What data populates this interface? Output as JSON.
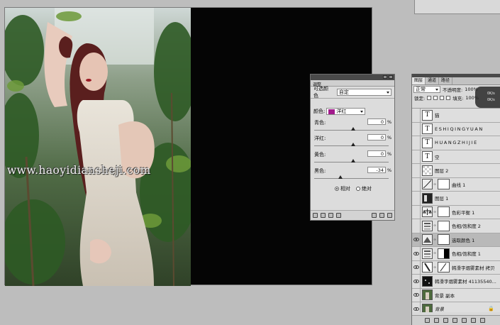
{
  "canvas": {
    "watermark": "www.haoyidiansheji.com"
  },
  "adjustments": {
    "tab_label": "调整",
    "header_label": "可选颜色",
    "preset_value": "自定",
    "colors_label": "颜色:",
    "color_value": "洋红",
    "color_swatch": "#a21a8c",
    "sliders": [
      {
        "label": "青色:",
        "value": "0",
        "unit": "%",
        "level": 0
      },
      {
        "label": "洋红:",
        "value": "0",
        "unit": "%",
        "level": 0
      },
      {
        "label": "黄色:",
        "value": "0",
        "unit": "%",
        "level": 0
      },
      {
        "label": "黑色:",
        "value": "-34",
        "unit": "%",
        "level": -34
      }
    ],
    "method_relative": "相对",
    "method_absolute": "绝对",
    "method_selected": "relative"
  },
  "layers": {
    "tabs": [
      "图层",
      "通道",
      "路径"
    ],
    "blend_mode": "正常",
    "opacity_label": "不透明度:",
    "opacity_value": "100%",
    "lock_label": "锁定:",
    "fill_label": "填充:",
    "fill_value": "100%",
    "loader_lines": [
      "0K/s",
      "0K/s"
    ],
    "items": [
      {
        "name": "猫",
        "kind": "text",
        "visible": false
      },
      {
        "name": "ESHIQINGYUAN",
        "kind": "text",
        "visible": false
      },
      {
        "name": "HUANGZHIJIE",
        "kind": "text",
        "visible": false
      },
      {
        "name": "空",
        "kind": "text",
        "visible": false
      },
      {
        "name": "图层 2",
        "kind": "transparent",
        "visible": false
      },
      {
        "name": "曲线 1",
        "kind": "curves",
        "visible": false
      },
      {
        "name": "图层 1",
        "kind": "image",
        "visible": false
      },
      {
        "name": "色彩平衡 1",
        "kind": "balance",
        "visible": false
      },
      {
        "name": "色相/饱和度 2",
        "kind": "hue",
        "visible": false
      },
      {
        "name": "选取颜色 1",
        "kind": "selective",
        "visible": true,
        "selected": true
      },
      {
        "name": "色相/饱和度 1",
        "kind": "hue",
        "visible": true
      },
      {
        "name": "韩滑字烟雾素材 拷贝",
        "kind": "smoke",
        "visible": true
      },
      {
        "name": "韩滑字烟雾素材 41135540...",
        "kind": "smoke2",
        "visible": true
      },
      {
        "name": "背景 副本",
        "kind": "photo",
        "visible": true
      },
      {
        "name": "背景",
        "kind": "photo",
        "visible": true,
        "locked": true
      }
    ]
  }
}
